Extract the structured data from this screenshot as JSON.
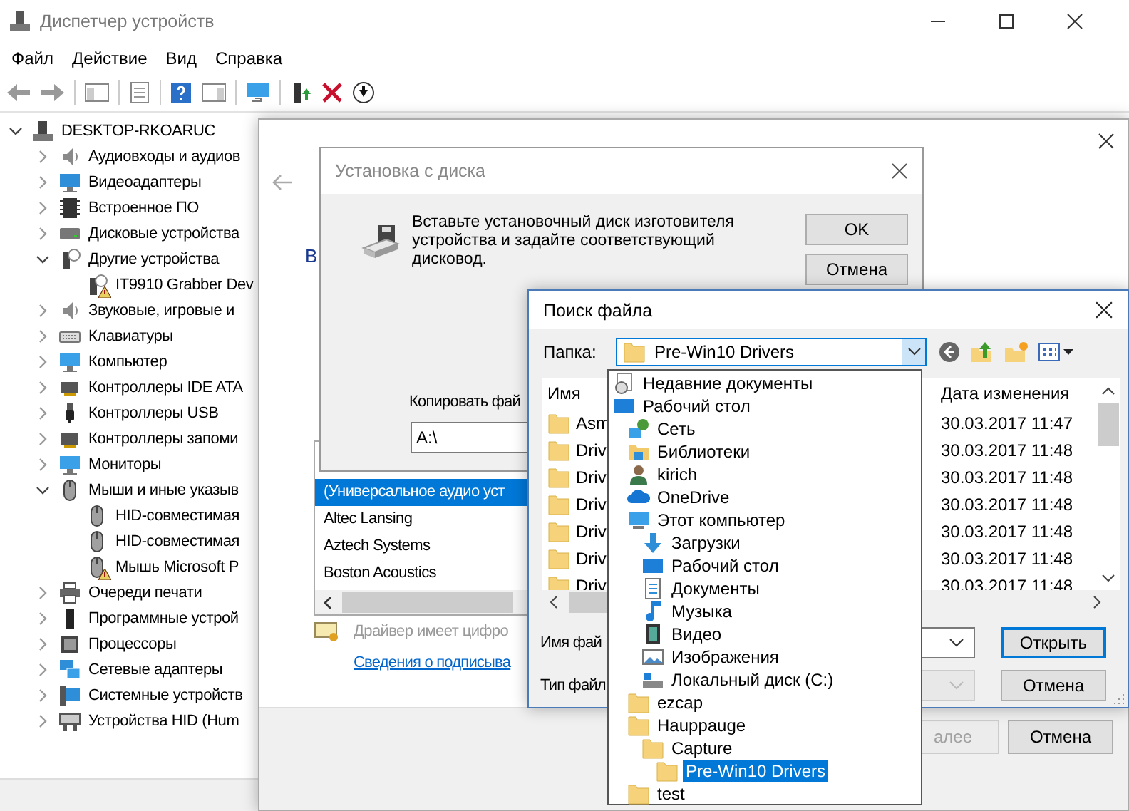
{
  "window": {
    "title": "Диспетчер устройств"
  },
  "menu": [
    "Файл",
    "Действие",
    "Вид",
    "Справка"
  ],
  "device_tree": {
    "label": "DESKTOP-RKOARUC",
    "kind": "computer",
    "expanded": true,
    "children": [
      {
        "label": "Аудиовходы и аудиов",
        "kind": "audio",
        "expanded": false
      },
      {
        "label": "Видеоадаптеры",
        "kind": "display",
        "expanded": false
      },
      {
        "label": "Встроенное ПО",
        "kind": "firmware",
        "expanded": false
      },
      {
        "label": "Дисковые устройства",
        "kind": "disk",
        "expanded": false
      },
      {
        "label": "Другие устройства",
        "kind": "unknown",
        "expanded": true,
        "children": [
          {
            "label": "IT9910 Grabber Dev",
            "kind": "unknown",
            "warning": true
          }
        ]
      },
      {
        "label": "Звуковые, игровые и",
        "kind": "audio",
        "expanded": false
      },
      {
        "label": "Клавиатуры",
        "kind": "keyboard",
        "expanded": false
      },
      {
        "label": "Компьютер",
        "kind": "monitor",
        "expanded": false
      },
      {
        "label": "Контроллеры IDE ATA",
        "kind": "controller",
        "expanded": false
      },
      {
        "label": "Контроллеры USB",
        "kind": "usb",
        "expanded": false
      },
      {
        "label": "Контроллеры запоми",
        "kind": "controller",
        "expanded": false
      },
      {
        "label": "Мониторы",
        "kind": "monitor",
        "expanded": false
      },
      {
        "label": "Мыши и иные указыв",
        "kind": "mouse",
        "expanded": true,
        "children": [
          {
            "label": "HID-совместимая",
            "kind": "mouse",
            "warning": false
          },
          {
            "label": "HID-совместимая",
            "kind": "mouse",
            "warning": false
          },
          {
            "label": "Мышь Microsoft P",
            "kind": "mouse",
            "warning": true
          }
        ]
      },
      {
        "label": "Очереди печати",
        "kind": "printer",
        "expanded": false
      },
      {
        "label": "Программные устрой",
        "kind": "tower",
        "expanded": false
      },
      {
        "label": "Процессоры",
        "kind": "cpu",
        "expanded": false
      },
      {
        "label": "Сетевые адаптеры",
        "kind": "network",
        "expanded": false
      },
      {
        "label": "Системные устройств",
        "kind": "system",
        "expanded": false
      },
      {
        "label": "Устройства HID (Hum",
        "kind": "hid",
        "expanded": false
      }
    ]
  },
  "wizard": {
    "heading": "В",
    "list": [
      {
        "label": "(Универсальное аудио уст",
        "selected": true
      },
      {
        "label": "Altec Lansing",
        "selected": false
      },
      {
        "label": "Aztech Systems",
        "selected": false
      },
      {
        "label": "Boston Acoustics",
        "selected": false
      }
    ],
    "signature_note": "Драйвер имеет цифро",
    "signature_link": "Сведения о подписыва",
    "buttons": [
      {
        "label": "алее",
        "disabled": true
      },
      {
        "label": "Отмена",
        "disabled": false
      }
    ]
  },
  "install_dialog": {
    "title": "Установка с диска",
    "message": "Вставьте установочный диск изготовителя устройства и задайте соответствующий дисковод.",
    "buttons": [
      "OK",
      "Отмена"
    ],
    "copy_label": "Копировать фай",
    "path_value": "A:\\"
  },
  "find_dialog": {
    "title": "Поиск файла",
    "folder_label": "Папка:",
    "folder_value": "Pre-Win10 Drivers",
    "columns": [
      "Имя",
      "Дата изменения"
    ],
    "rows": [
      {
        "name": "Asm",
        "date": "30.03.2017 11:47"
      },
      {
        "name": "Driv",
        "date": "30.03.2017 11:48"
      },
      {
        "name": "Driv",
        "date": "30.03.2017 11:48"
      },
      {
        "name": "Driv",
        "date": "30.03.2017 11:48"
      },
      {
        "name": "Driv",
        "date": "30.03.2017 11:48"
      },
      {
        "name": "Driv",
        "date": "30.03.2017 11:48"
      },
      {
        "name": "Driv",
        "date": "30.03.2017 11:48"
      }
    ],
    "filename_label": "Имя фай",
    "filetype_label": "Тип файл",
    "filetype_disabled": true,
    "buttons": [
      {
        "label": "Открыть",
        "default": true
      },
      {
        "label": "Отмена",
        "default": false
      }
    ]
  },
  "folder_dropdown": {
    "items": [
      {
        "label": "Недавние документы",
        "kind": "recent",
        "selected": false
      },
      {
        "label": "Рабочий стол",
        "kind": "desktop",
        "selected": false,
        "children": [
          {
            "label": "Сеть",
            "kind": "network",
            "selected": false
          },
          {
            "label": "Библиотеки",
            "kind": "libraries",
            "selected": false
          },
          {
            "label": "kirich",
            "kind": "user",
            "selected": false
          },
          {
            "label": "OneDrive",
            "kind": "cloud",
            "selected": false
          },
          {
            "label": "Этот компьютер",
            "kind": "computer",
            "selected": false,
            "children": [
              {
                "label": "Загрузки",
                "kind": "downloads",
                "selected": false
              },
              {
                "label": "Рабочий стол",
                "kind": "desktop",
                "selected": false
              },
              {
                "label": "Документы",
                "kind": "documents",
                "selected": false
              },
              {
                "label": "Музыка",
                "kind": "music",
                "selected": false
              },
              {
                "label": "Видео",
                "kind": "video",
                "selected": false
              },
              {
                "label": "Изображения",
                "kind": "pictures",
                "selected": false
              },
              {
                "label": "Локальный диск (C:)",
                "kind": "drive",
                "selected": false
              }
            ]
          },
          {
            "label": "ezcap",
            "kind": "folder",
            "selected": false
          },
          {
            "label": "Hauppauge",
            "kind": "folder",
            "selected": false,
            "children": [
              {
                "label": "Capture",
                "kind": "folder",
                "selected": false,
                "children": [
                  {
                    "label": "Pre-Win10 Drivers",
                    "kind": "folder",
                    "selected": true
                  }
                ]
              }
            ]
          },
          {
            "label": "test",
            "kind": "folder",
            "selected": false
          }
        ]
      }
    ]
  }
}
